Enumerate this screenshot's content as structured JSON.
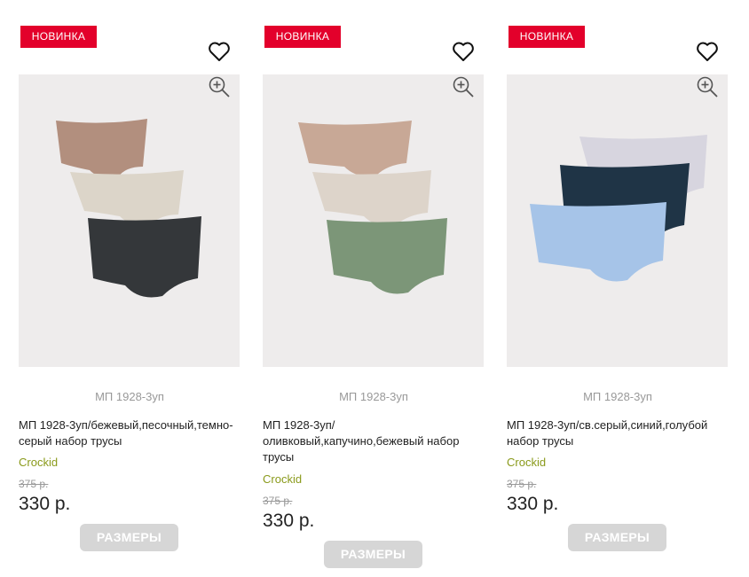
{
  "products": [
    {
      "badge": "НОВИНКА",
      "sku": "МП 1928-3уп",
      "name": "МП 1928-3уп/бежевый,песочный,темно-серый набор трусы",
      "brand": "Crockid",
      "old_price": "375 р.",
      "price": "330 р.",
      "button": "РАЗМЕРЫ",
      "colors": [
        "#b28f7e",
        "#dcd5c9",
        "#34373a"
      ]
    },
    {
      "badge": "НОВИНКА",
      "sku": "МП 1928-3уп",
      "name": "МП 1928-3уп/оливковый,капучино,бежевый набор трусы",
      "brand": "Crockid",
      "old_price": "375 р.",
      "price": "330 р.",
      "button": "РАЗМЕРЫ",
      "colors": [
        "#c8a896",
        "#ddd4ca",
        "#7c9678"
      ]
    },
    {
      "badge": "НОВИНКА",
      "sku": "МП 1928-3уп",
      "name": "МП 1928-3уп/св.серый,синий,голубой набор трусы",
      "brand": "Crockid",
      "old_price": "375 р.",
      "price": "330 р.",
      "button": "РАЗМЕРЫ",
      "colors": [
        "#d7d5df",
        "#1f3446",
        "#a6c4e8"
      ]
    }
  ],
  "icons": {
    "favorite": "heart-outline-icon",
    "zoom": "zoom-in-icon"
  },
  "accent_colors": {
    "badge": "#e3002b",
    "brand": "#8a9a1b",
    "button": "#d6d6d6"
  }
}
